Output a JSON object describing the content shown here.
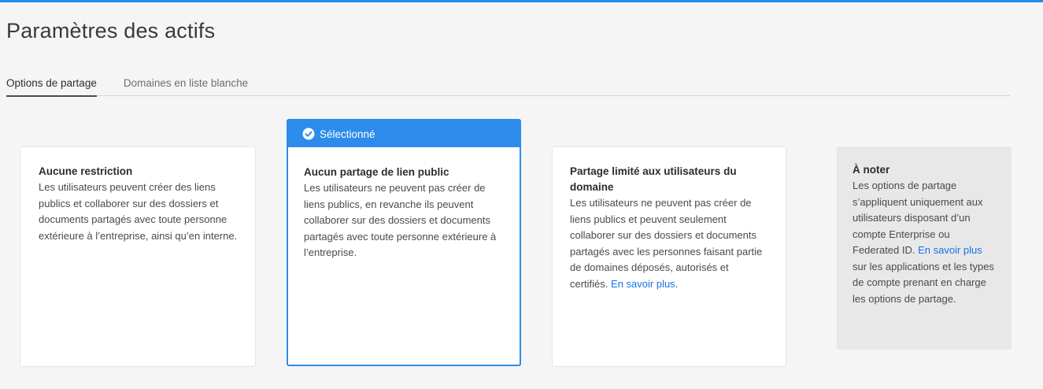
{
  "page": {
    "title": "Paramètres des actifs"
  },
  "tabs": [
    {
      "label": "Options de partage",
      "active": true
    },
    {
      "label": "Domaines en liste blanche",
      "active": false
    }
  ],
  "cards": [
    {
      "title": "Aucune restriction",
      "description": "Les utilisateurs peuvent créer des liens publics et collaborer sur des dossiers et documents partagés avec toute personne extérieure à l’entreprise, ainsi qu’en interne.",
      "selected": false
    },
    {
      "selected_label": "Sélectionné",
      "title": "Aucun partage de lien public",
      "description": "Les utilisateurs ne peuvent pas créer de liens publics, en revanche ils peuvent collaborer sur des dossiers et documents partagés avec toute personne extérieure à l’entreprise.",
      "selected": true
    },
    {
      "title": "Partage limité aux utilisateurs du domaine",
      "description": "Les utilisateurs ne peuvent pas créer de liens publics et peuvent seulement collaborer sur des dossiers et documents partagés avec les personnes faisant partie de domaines déposés, autorisés et certifiés.",
      "link": "En savoir plus",
      "link_suffix": ".",
      "selected": false
    }
  ],
  "note": {
    "title": "À noter",
    "text_before": "Les options de partage s’appliquent uniquement aux utilisateurs disposant d’un compte Enterprise ou Federated ID.",
    "link": "En savoir plus",
    "text_after": "sur les applications et les types de compte prenant en charge les options de partage."
  },
  "colors": {
    "accent": "#2d8ceb",
    "link": "#1473e6",
    "background": "#f5f5f5",
    "note_background": "#e8e8e8"
  },
  "icons": {
    "selected": "check-circle-icon"
  }
}
